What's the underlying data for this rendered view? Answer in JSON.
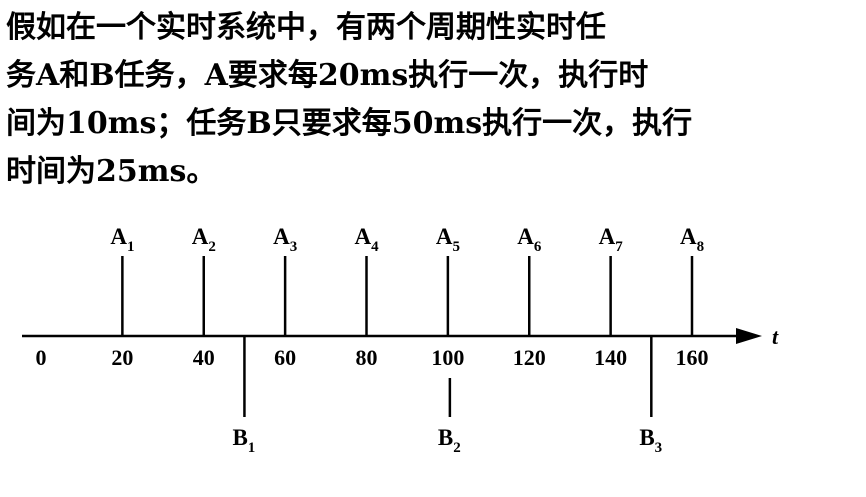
{
  "problem": {
    "lines": [
      "假如在一个实时系统中，有两个周期性实时任",
      "务A和B任务，A要求每20ms执行一次，执行时",
      "间为10ms；任务B只要求每50ms执行一次，执行",
      "时间为25ms。"
    ]
  },
  "timeline": {
    "axis_label": "t",
    "ticks": [
      {
        "value": 0,
        "label": "0"
      },
      {
        "value": 20,
        "label": "20"
      },
      {
        "value": 40,
        "label": "40"
      },
      {
        "value": 60,
        "label": "60"
      },
      {
        "value": 80,
        "label": "80"
      },
      {
        "value": 100,
        "label": "100"
      },
      {
        "value": 120,
        "label": "120"
      },
      {
        "value": 140,
        "label": "140"
      },
      {
        "value": 160,
        "label": "160"
      }
    ],
    "a_arrivals": [
      {
        "t": 20,
        "base": "A",
        "sub": "1"
      },
      {
        "t": 40,
        "base": "A",
        "sub": "2"
      },
      {
        "t": 60,
        "base": "A",
        "sub": "3"
      },
      {
        "t": 80,
        "base": "A",
        "sub": "4"
      },
      {
        "t": 100,
        "base": "A",
        "sub": "5"
      },
      {
        "t": 120,
        "base": "A",
        "sub": "6"
      },
      {
        "t": 140,
        "base": "A",
        "sub": "7"
      },
      {
        "t": 160,
        "base": "A",
        "sub": "8"
      }
    ],
    "b_arrivals": [
      {
        "t": 50,
        "base": "B",
        "sub": "1"
      },
      {
        "t": 100,
        "base": "B",
        "sub": "2"
      },
      {
        "t": 150,
        "base": "B",
        "sub": "3"
      }
    ]
  }
}
